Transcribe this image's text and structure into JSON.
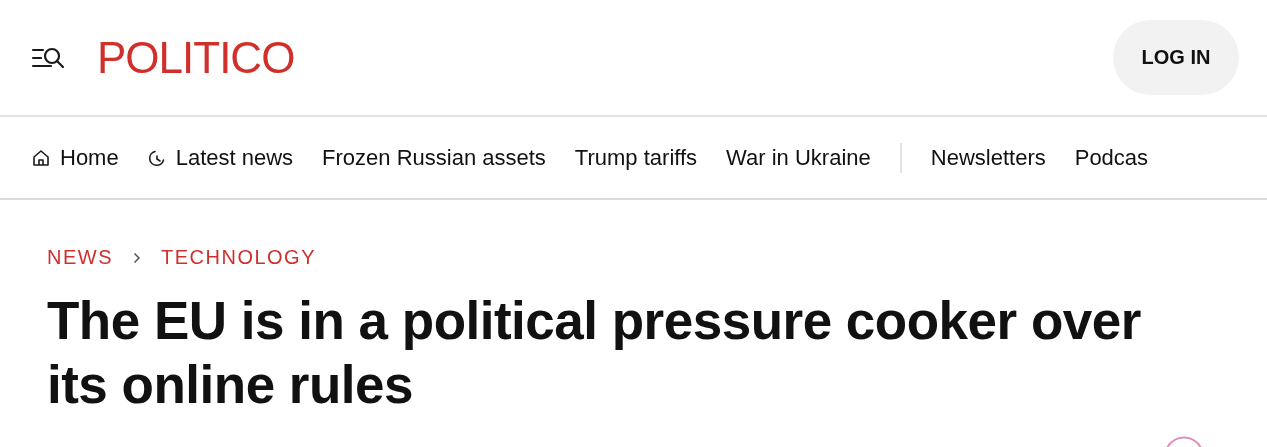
{
  "header": {
    "logo": "POLITICO",
    "login": "LOG IN"
  },
  "nav": [
    {
      "kind": "home",
      "label": "Home"
    },
    {
      "kind": "recent",
      "label": "Latest news"
    },
    {
      "kind": "plain",
      "label": "Frozen Russian assets"
    },
    {
      "kind": "plain",
      "label": "Trump tariffs"
    },
    {
      "kind": "plain",
      "label": "War in Ukraine"
    },
    {
      "kind": "divider"
    },
    {
      "kind": "plain",
      "label": "Newsletters"
    },
    {
      "kind": "plain",
      "label": "Podcas"
    }
  ],
  "breadcrumb": [
    "NEWS",
    "TECHNOLOGY"
  ],
  "headline": "The EU is in a political pressure cooker over its online rules"
}
